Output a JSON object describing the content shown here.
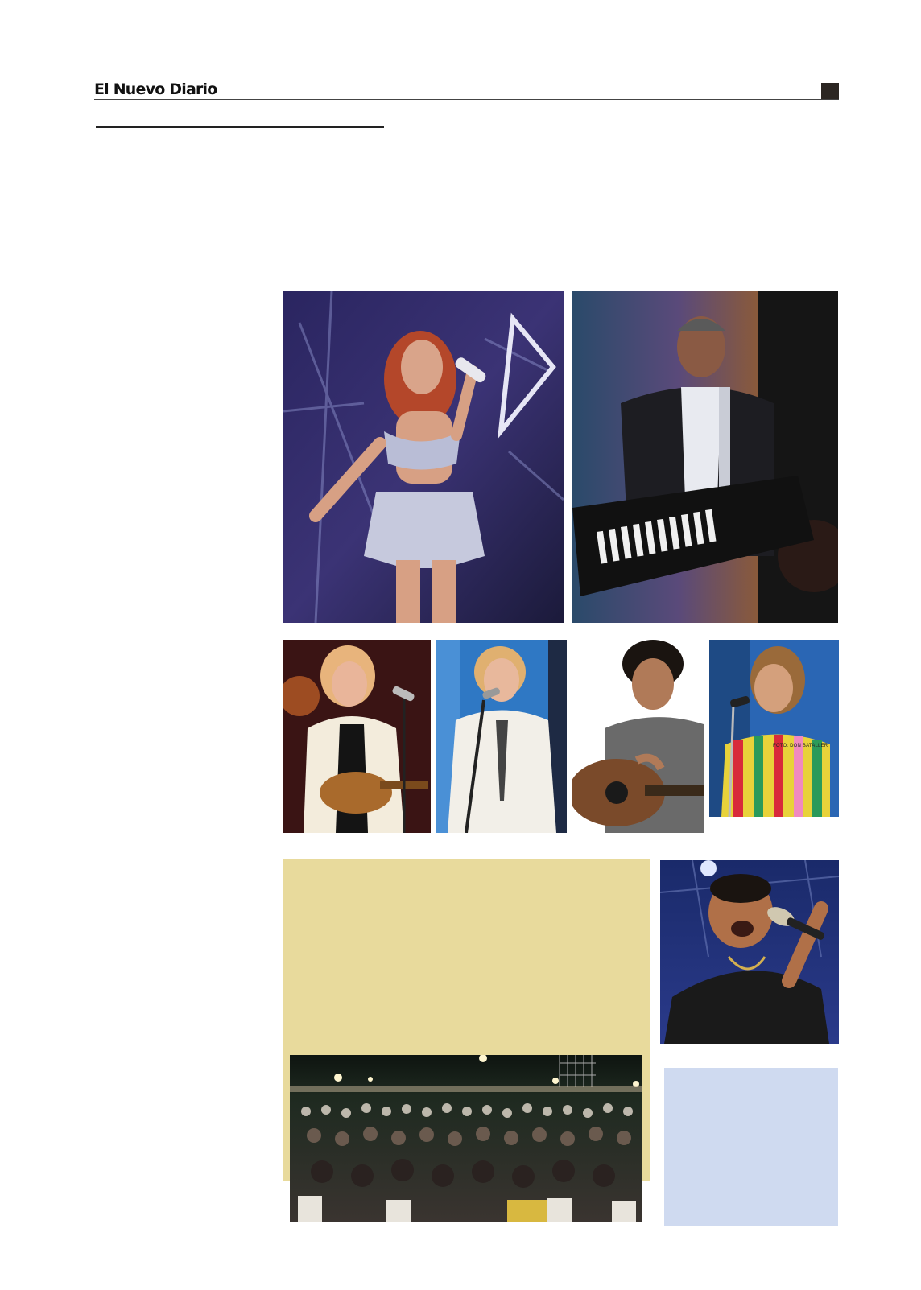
{
  "header": {
    "masthead": "El Nuevo Diario"
  },
  "photos": [
    {
      "id": "singer-female-sequins",
      "desc": "female pop singer in sequined outfit with microphone"
    },
    {
      "id": "keytar-player",
      "desc": "male performer playing keytar"
    },
    {
      "id": "woman-ukulele",
      "desc": "woman singing with ukulele"
    },
    {
      "id": "woman-singer-microphone",
      "desc": "woman singing at microphone stand"
    },
    {
      "id": "young-guitarist",
      "desc": "young man with acoustic guitar"
    },
    {
      "id": "young-woman-singer",
      "desc": "young woman singing into microphone"
    },
    {
      "id": "male-singer-black-shirt",
      "desc": "male singer in black shirt with microphone"
    },
    {
      "id": "crowd-audience",
      "desc": "outdoor crowd seated in plastic chairs at night"
    }
  ],
  "photo_credit": "FOTO: DON BATALLER",
  "colors": {
    "beige_box": "#e8da9c",
    "blue_box": "#cfdaf0",
    "rule": "#444444"
  }
}
